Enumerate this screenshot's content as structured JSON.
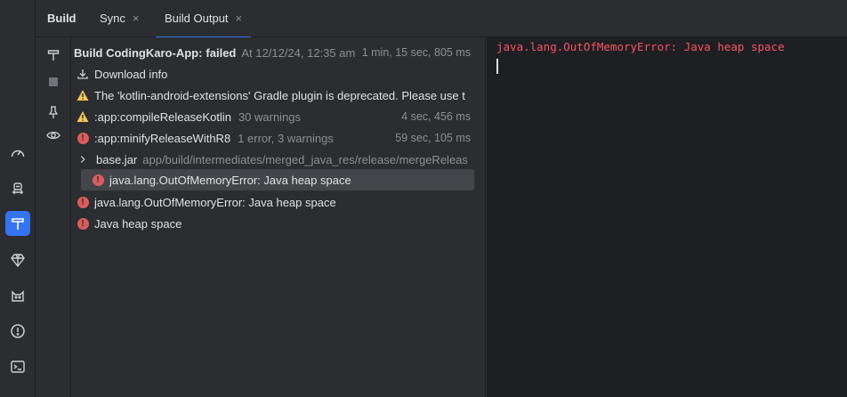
{
  "tabs": [
    {
      "label": "Build"
    },
    {
      "label": "Sync",
      "close": "×"
    },
    {
      "label": "Build Output",
      "close": "×"
    }
  ],
  "tree": {
    "root": {
      "title": "Build CodingKaro-App:",
      "status": "failed",
      "timestamp": "At 12/12/24, 12:35 am",
      "duration": "1 min, 15 sec, 805 ms"
    },
    "download": "Download info",
    "warning_deprecated": "The 'kotlin-android-extensions' Gradle plugin is deprecated. Please use t",
    "compile_task": {
      "name": ":app:compileReleaseKotlin",
      "detail": "30 warnings",
      "time": "4 sec, 456 ms"
    },
    "minify_task": {
      "name": ":app:minifyReleaseWithR8",
      "detail": "1 error, 3 warnings",
      "time": "59 sec, 105 ms"
    },
    "basejar": {
      "name": "base.jar",
      "path": "app/build/intermediates/merged_java_res/release/mergeReleas"
    },
    "oom_child": "java.lang.OutOfMemoryError: Java heap space",
    "oom_top": "java.lang.OutOfMemoryError: Java heap space",
    "heap": "Java heap space"
  },
  "console": {
    "text": "java.lang.OutOfMemoryError: Java heap space"
  },
  "colors": {
    "accent": "#3574f0",
    "error": "#db5c5c",
    "warning": "#f2c55c",
    "console_error": "#f75464"
  }
}
